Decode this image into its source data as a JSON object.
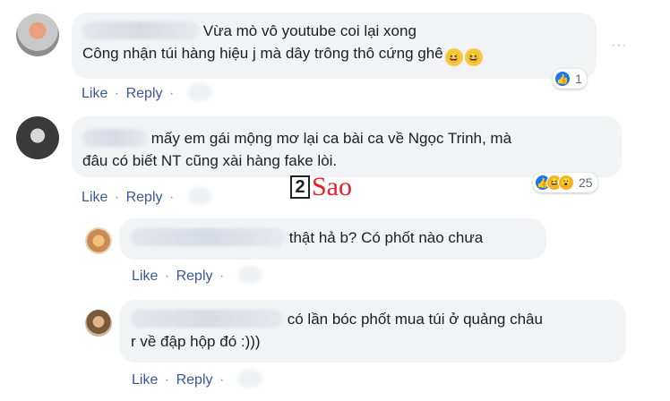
{
  "comments": [
    {
      "text_lines": [
        "Vừa mò vô youtube coi lại xong",
        "Công nhận túi hàng hiệu j mà dây trông thô cứng ghê"
      ],
      "emoji": [
        "rolling-on-floor-laughing",
        "rolling-on-floor-laughing"
      ],
      "reaction_count": "1",
      "like_label": "Like",
      "reply_label": "Reply",
      "separator": "·",
      "more_label": "···"
    },
    {
      "text_lines": [
        "mấy em gái mộng mơ lại ca bài ca về Ngọc Trinh, mà",
        "đâu có biết NT cũng xài hàng fake lòi."
      ],
      "reaction_count": "25",
      "like_label": "Like",
      "reply_label": "Reply",
      "separator": "·"
    },
    {
      "text_lines": [
        "thật hả b? Có phốt nào chưa"
      ],
      "like_label": "Like",
      "reply_label": "Reply",
      "separator": "·"
    },
    {
      "text_lines": [
        "có lần bóc phốt mua túi ở quảng châu",
        "r về đập hộp đó :)))"
      ],
      "like_label": "Like",
      "reply_label": "Reply",
      "separator": "·"
    }
  ],
  "watermark": {
    "number": "2",
    "word": "Sao"
  },
  "colors": {
    "link": "#385898",
    "bubble": "#f2f3f5",
    "like": "#1877f2",
    "brand_red": "#e21f26"
  }
}
